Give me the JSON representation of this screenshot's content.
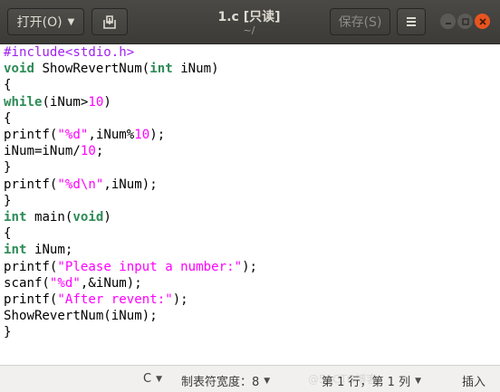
{
  "window": {
    "title": "1.c [只读]",
    "subtitle": "~/"
  },
  "toolbar": {
    "open_label": "打开(O)",
    "save_label": "保存(S)"
  },
  "icons": {
    "open_dropdown": "chevron-down-icon",
    "new_document": "new-document-icon",
    "menu": "hamburger-menu-icon",
    "minimize": "minimize-icon",
    "maximize": "maximize-icon",
    "close": "close-icon"
  },
  "editor": {
    "lines": [
      [
        {
          "t": "pp",
          "v": "#include<stdio.h>"
        }
      ],
      [
        {
          "t": "ty",
          "v": "void"
        },
        {
          "t": "",
          "v": " ShowRevertNum("
        },
        {
          "t": "ty",
          "v": "int"
        },
        {
          "t": "",
          "v": " iNum)"
        }
      ],
      [
        {
          "t": "",
          "v": "{"
        }
      ],
      [
        {
          "t": "kw",
          "v": "while"
        },
        {
          "t": "",
          "v": "(iNum>"
        },
        {
          "t": "num",
          "v": "10"
        },
        {
          "t": "",
          "v": ")"
        }
      ],
      [
        {
          "t": "",
          "v": "{"
        }
      ],
      [
        {
          "t": "",
          "v": "printf("
        },
        {
          "t": "str",
          "v": "\"%d\""
        },
        {
          "t": "",
          "v": ",iNum%"
        },
        {
          "t": "num",
          "v": "10"
        },
        {
          "t": "",
          "v": ");"
        }
      ],
      [
        {
          "t": "",
          "v": "iNum=iNum/"
        },
        {
          "t": "num",
          "v": "10"
        },
        {
          "t": "",
          "v": ";"
        }
      ],
      [
        {
          "t": "",
          "v": "}"
        }
      ],
      [
        {
          "t": "",
          "v": "printf("
        },
        {
          "t": "str",
          "v": "\"%d\\n\""
        },
        {
          "t": "",
          "v": ",iNum);"
        }
      ],
      [
        {
          "t": "",
          "v": "}"
        }
      ],
      [
        {
          "t": "ty",
          "v": "int"
        },
        {
          "t": "",
          "v": " main("
        },
        {
          "t": "ty",
          "v": "void"
        },
        {
          "t": "",
          "v": ")"
        }
      ],
      [
        {
          "t": "",
          "v": "{"
        }
      ],
      [
        {
          "t": "ty",
          "v": "int"
        },
        {
          "t": "",
          "v": " iNum;"
        }
      ],
      [
        {
          "t": "",
          "v": "printf("
        },
        {
          "t": "str",
          "v": "\"Please input a number:\""
        },
        {
          "t": "",
          "v": ");"
        }
      ],
      [
        {
          "t": "",
          "v": "scanf("
        },
        {
          "t": "str",
          "v": "\"%d\""
        },
        {
          "t": "",
          "v": ",&iNum);"
        }
      ],
      [
        {
          "t": "",
          "v": "printf("
        },
        {
          "t": "str",
          "v": "\"After revent:\""
        },
        {
          "t": "",
          "v": ");"
        }
      ],
      [
        {
          "t": "",
          "v": "ShowRevertNum(iNum);"
        }
      ],
      [
        {
          "t": "",
          "v": "}"
        }
      ]
    ]
  },
  "statusbar": {
    "language": "C",
    "tab_width": "制表符宽度：8",
    "position": "第 1 行，第 1 列",
    "mode": "插入",
    "watermark": "@51CTO博客"
  }
}
